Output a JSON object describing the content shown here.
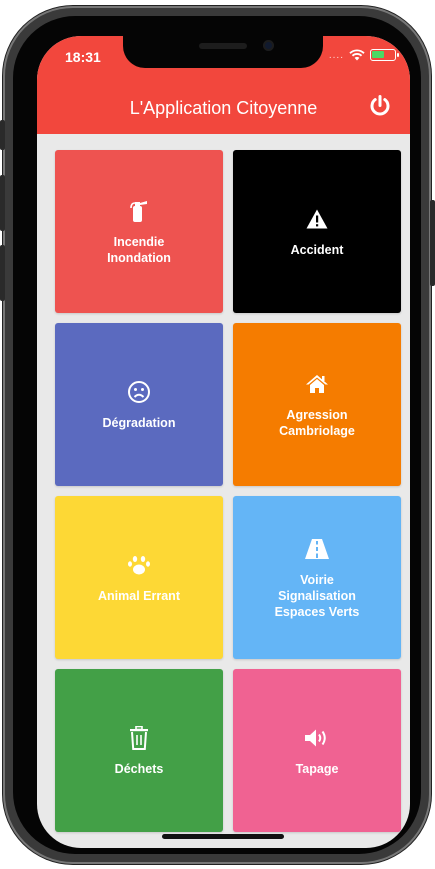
{
  "status_bar": {
    "time": "18:31",
    "dots": "....",
    "battery_color": "#4cd964"
  },
  "header": {
    "title": "L'Application Citoyenne",
    "background": "#f2473d",
    "power_icon": "power-icon"
  },
  "tiles": [
    {
      "label": "Incendie\nInondation",
      "color": "#ee5350",
      "icon": "fire-extinguisher-icon"
    },
    {
      "label": "Accident",
      "color": "#000000",
      "icon": "warning-icon"
    },
    {
      "label": "Dégradation",
      "color": "#5b6abf",
      "icon": "sad-face-icon"
    },
    {
      "label": "Agression\nCambriolage",
      "color": "#f57c00",
      "icon": "home-icon"
    },
    {
      "label": "Animal Errant",
      "color": "#fdd835",
      "icon": "paw-icon"
    },
    {
      "label": "Voirie\nSignalisation\nEspaces Verts",
      "color": "#64b5f6",
      "icon": "road-icon"
    },
    {
      "label": "Déchets",
      "color": "#43a047",
      "icon": "trash-icon"
    },
    {
      "label": "Tapage",
      "color": "#f06292",
      "icon": "volume-icon"
    }
  ]
}
